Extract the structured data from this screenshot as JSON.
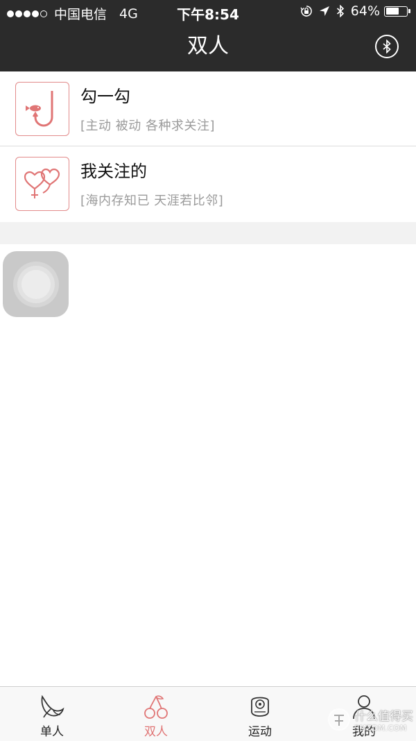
{
  "status_bar": {
    "signal_filled": 4,
    "signal_total": 5,
    "carrier": "中国电信",
    "network": "4G",
    "time": "下午8:54",
    "battery_percent": "64%",
    "battery_level": 0.64,
    "icons": [
      "orientation-lock-icon",
      "location-arrow-icon",
      "bluetooth-icon",
      "battery-icon"
    ]
  },
  "nav": {
    "title": "双人",
    "right_button_icon": "bluetooth-icon"
  },
  "list": {
    "items": [
      {
        "title": "勾一勾",
        "subtitle": "[主动 被动 各种求关注]",
        "icon": "fish-hook-icon"
      },
      {
        "title": "我关注的",
        "subtitle": "[海内存知已 天涯若比邻]",
        "icon": "heart-balloons-icon"
      }
    ]
  },
  "tab_bar": {
    "tabs": [
      {
        "label": "单人",
        "icon": "banana-icon",
        "active": false
      },
      {
        "label": "双人",
        "icon": "cherry-icon",
        "active": true
      },
      {
        "label": "运动",
        "icon": "toy-icon",
        "active": false
      },
      {
        "label": "我的",
        "icon": "person-icon",
        "active": false
      }
    ]
  },
  "watermark": {
    "main": "什么值得买",
    "sub": "SMZDM.COM"
  },
  "colors": {
    "header_bg": "#2b2b2b",
    "accent": "#e07575",
    "icon_border": "#e28a8a",
    "subtitle": "#9a9a9a",
    "tab_bar_bg": "#f8f8f8"
  }
}
